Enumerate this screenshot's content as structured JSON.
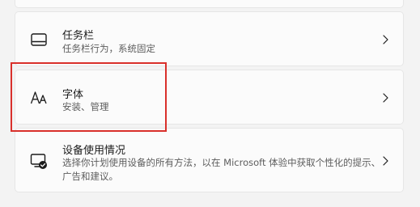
{
  "settings_list": {
    "items": [
      {
        "title": "任务栏",
        "subtitle": "任务栏行为，系统固定",
        "icon": "taskbar-icon"
      },
      {
        "title": "字体",
        "subtitle": "安装、管理",
        "icon": "font-icon"
      },
      {
        "title": "设备使用情况",
        "subtitle": "选择你计划使用设备的所有方法，以在 Microsoft 体验中获取个性化的提示、广告和建议。",
        "icon": "device-usage-icon"
      }
    ]
  },
  "colors": {
    "background": "#f3f3f3",
    "card": "#fbfbfb",
    "highlight": "#d9302b"
  }
}
